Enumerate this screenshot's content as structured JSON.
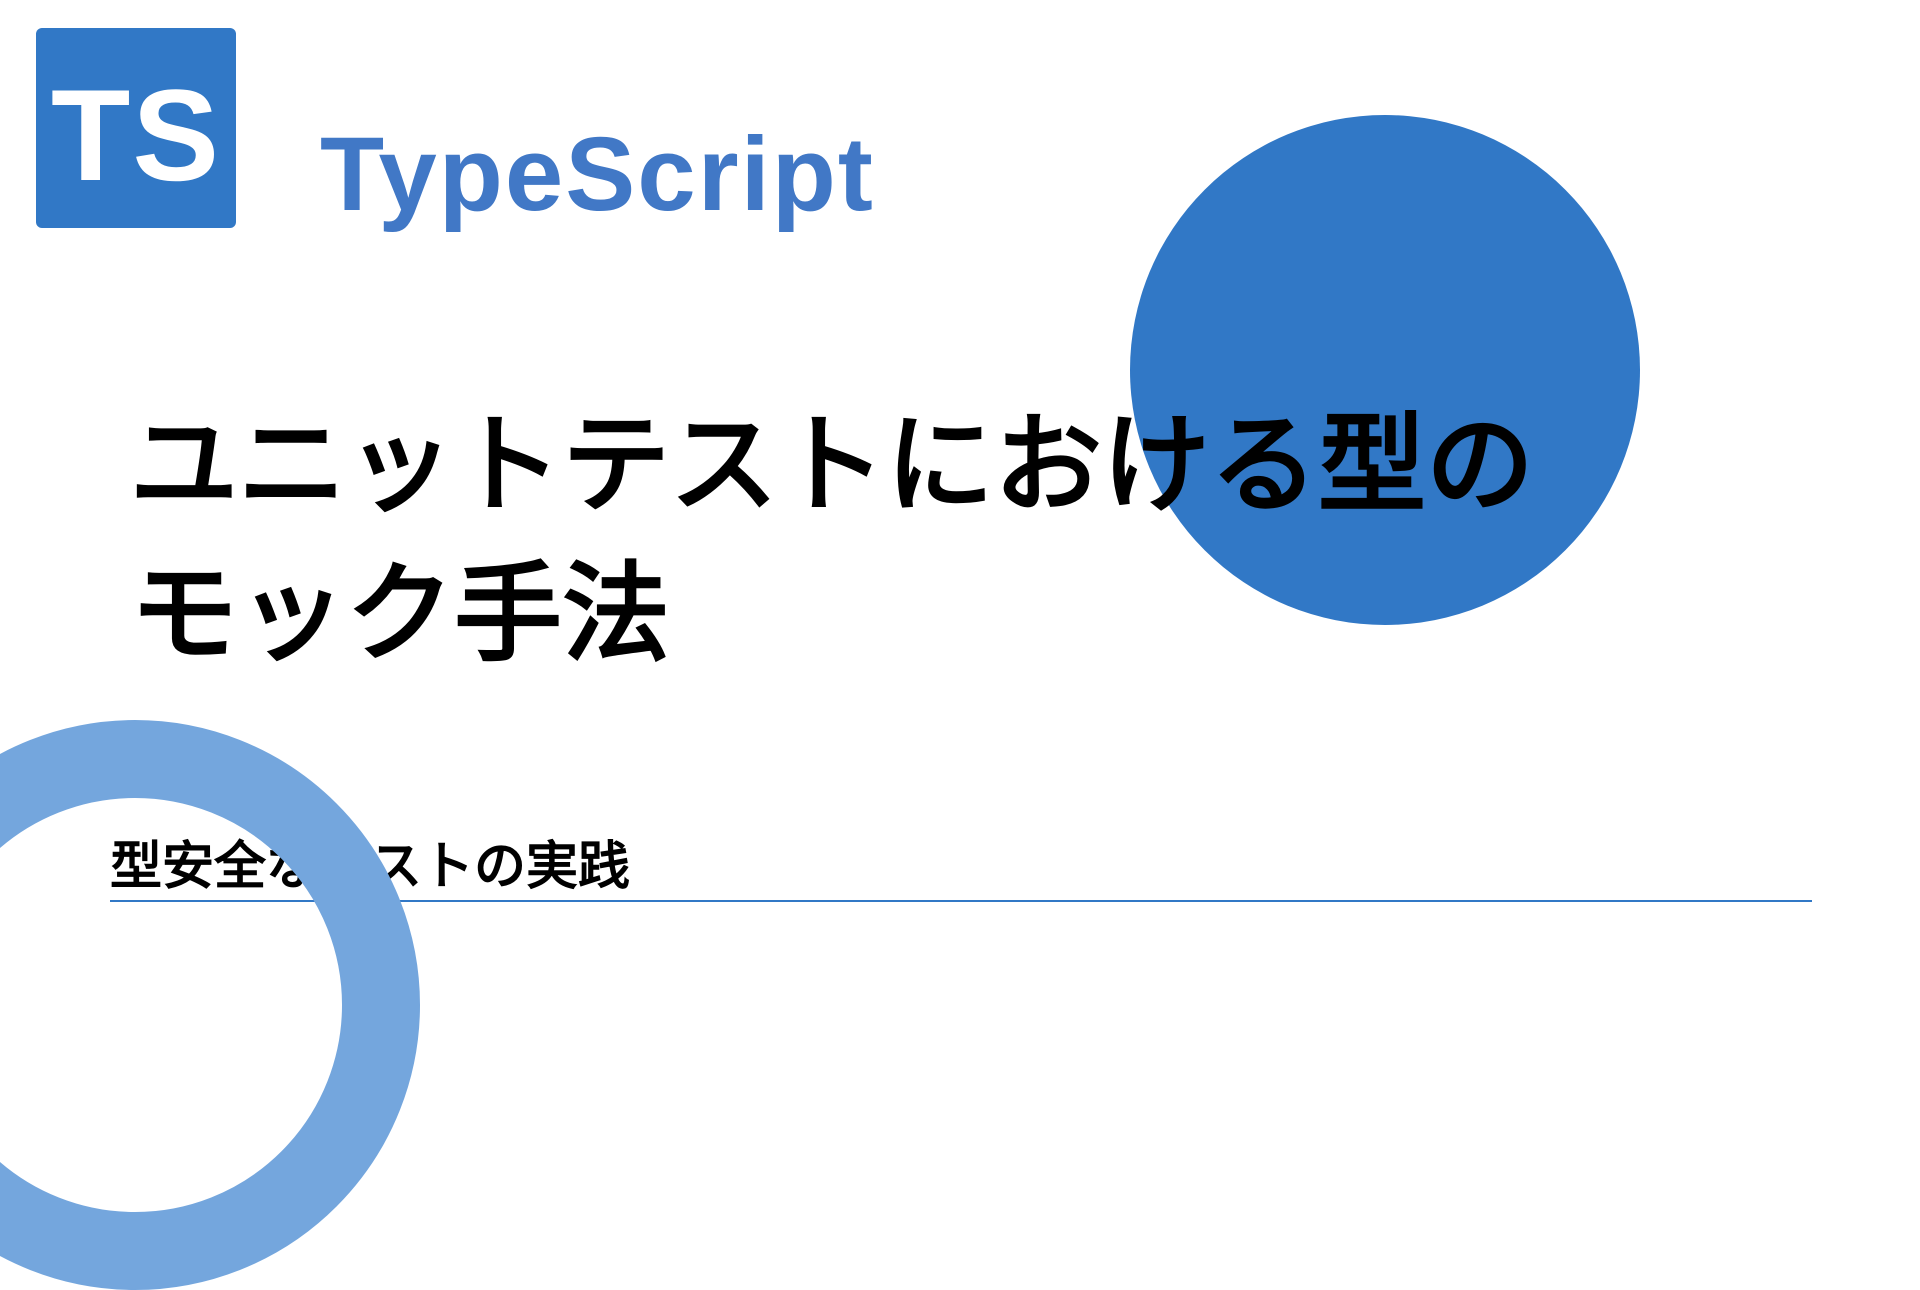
{
  "logo": {
    "abbreviation": "TS"
  },
  "brand": "TypeScript",
  "title": "ユニットテストにおける型の\nモック手法",
  "subtitle": "型安全なテストの実践",
  "colors": {
    "primary": "#3178c6",
    "secondary": "#74a6dd"
  }
}
